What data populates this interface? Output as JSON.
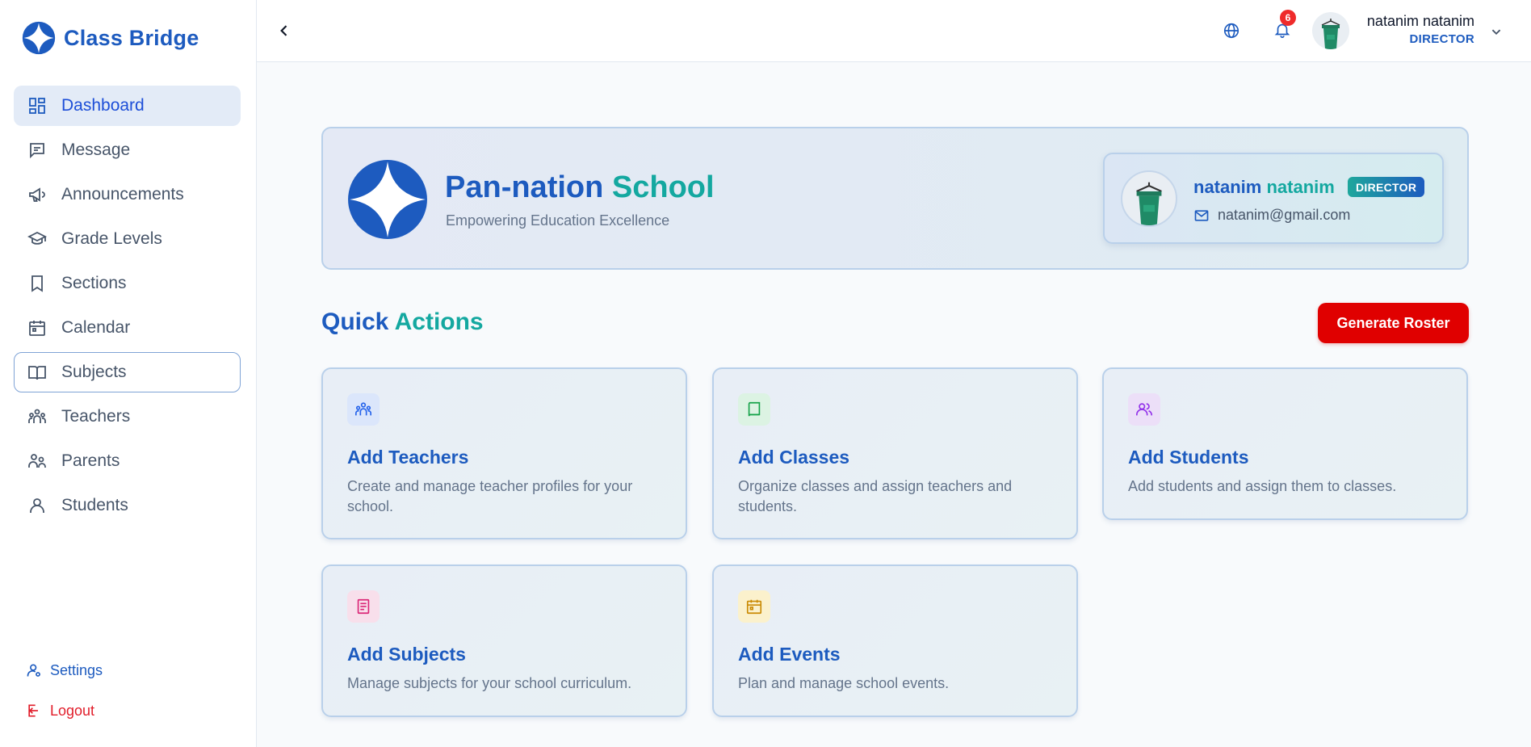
{
  "brand": {
    "name": "Class Bridge"
  },
  "sidebar": {
    "items": [
      {
        "label": "Dashboard"
      },
      {
        "label": "Message"
      },
      {
        "label": "Announcements"
      },
      {
        "label": "Grade Levels"
      },
      {
        "label": "Sections"
      },
      {
        "label": "Calendar"
      },
      {
        "label": "Subjects"
      },
      {
        "label": "Teachers"
      },
      {
        "label": "Parents"
      },
      {
        "label": "Students"
      }
    ],
    "settings_label": "Settings",
    "logout_label": "Logout"
  },
  "header": {
    "notification_count": "6",
    "user_name": "natanim natanim",
    "user_role": "DIRECTOR"
  },
  "hero": {
    "school_name_part1": "Pan-nation",
    "school_name_part2": "School",
    "tagline": "Empowering Education Excellence",
    "profile": {
      "first_name": "natanim",
      "last_name": "natanim",
      "role_badge": "DIRECTOR",
      "email": "natanim@gmail.com"
    }
  },
  "quick_actions": {
    "title_part1": "Quick",
    "title_part2": "Actions",
    "roster_button": "Generate Roster",
    "cards": [
      {
        "title": "Add Teachers",
        "description": "Create and manage teacher profiles for your school.",
        "icon": "teachers-icon",
        "color": "#2563eb"
      },
      {
        "title": "Add Classes",
        "description": "Organize classes and assign teachers and students.",
        "icon": "book-icon",
        "color": "#16a34a"
      },
      {
        "title": "Add Students",
        "description": "Add students and assign them to classes.",
        "icon": "students-icon",
        "color": "#9333ea"
      },
      {
        "title": "Add Subjects",
        "description": "Manage subjects for your school curriculum.",
        "icon": "document-icon",
        "color": "#db2777"
      },
      {
        "title": "Add Events",
        "description": "Plan and manage school events.",
        "icon": "calendar-icon",
        "color": "#ca8a04"
      }
    ]
  },
  "colors": {
    "primary": "#1d5bbf",
    "accent": "#14a8a0",
    "danger": "#e00000",
    "active_bg": "#e3ebf7"
  }
}
